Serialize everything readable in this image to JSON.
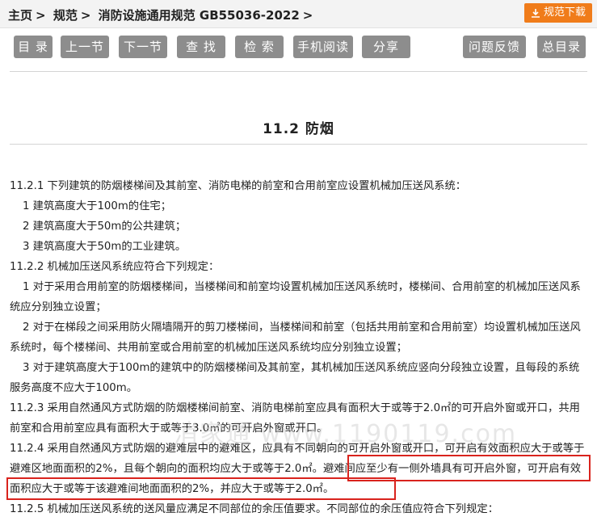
{
  "breadcrumb": {
    "items": [
      "主页",
      "规范",
      "消防设施通用规范 GB55036-2022"
    ],
    "separator": ">"
  },
  "download_button": {
    "label": "规范下载",
    "color": "#f07c1a"
  },
  "toolbar": {
    "buttons": [
      "目 录",
      "上一节",
      "下一节",
      "查 找",
      "检 索",
      "手机阅读",
      "分享",
      "问题反馈",
      "总目录"
    ]
  },
  "section_title": "11.2 防烟",
  "paragraphs": [
    "11.2.1 下列建筑的防烟楼梯间及其前室、消防电梯的前室和合用前室应设置机械加压送风系统：",
    "1 建筑高度大于100m的住宅；",
    "2 建筑高度大于50m的公共建筑；",
    "3 建筑高度大于50m的工业建筑。",
    "11.2.2 机械加压送风系统应符合下列规定：",
    "1 对于采用合用前室的防烟楼梯间，当楼梯间和前室均设置机械加压送风系统时，楼梯间、合用前室的机械加压送风系统应分别独立设置；",
    "2 对于在梯段之间采用防火隔墙隔开的剪刀楼梯间，当楼梯间和前室（包括共用前室和合用前室）均设置机械加压送风系统时，每个楼梯间、共用前室或合用前室的机械加压送风系统均应分别独立设置；",
    "3 对于建筑高度大于100m的建筑中的防烟楼梯间及其前室，其机械加压送风系统应竖向分段独立设置，且每段的系统服务高度不应大于100m。",
    "11.2.3 采用自然通风方式防烟的防烟楼梯间前室、消防电梯前室应具有面积大于或等于2.0㎡的可开启外窗或开口，共用前室和合用前室应具有面积大于或等于3.0㎡的可开启外窗或开口。",
    "11.2.4 采用自然通风方式防烟的避难层中的避难区，应具有不同朝向的可开启外窗或开口，可开启有效面积应大于或等于避难区地面面积的2%，且每个朝向的面积均应大于或等于2.0㎡。避难间应至少有一侧外墙具有可开启外窗，可开启有效面积应大于或等于该避难间地面面积的2%，并应大于或等于2.0㎡。",
    "11.2.5 机械加压送风系统的送风量应满足不同部位的余压值要求。不同部位的余压值应符合下列规定："
  ],
  "watermark": "消家通 www.1190119.com",
  "highlight_color": "#d9231d"
}
